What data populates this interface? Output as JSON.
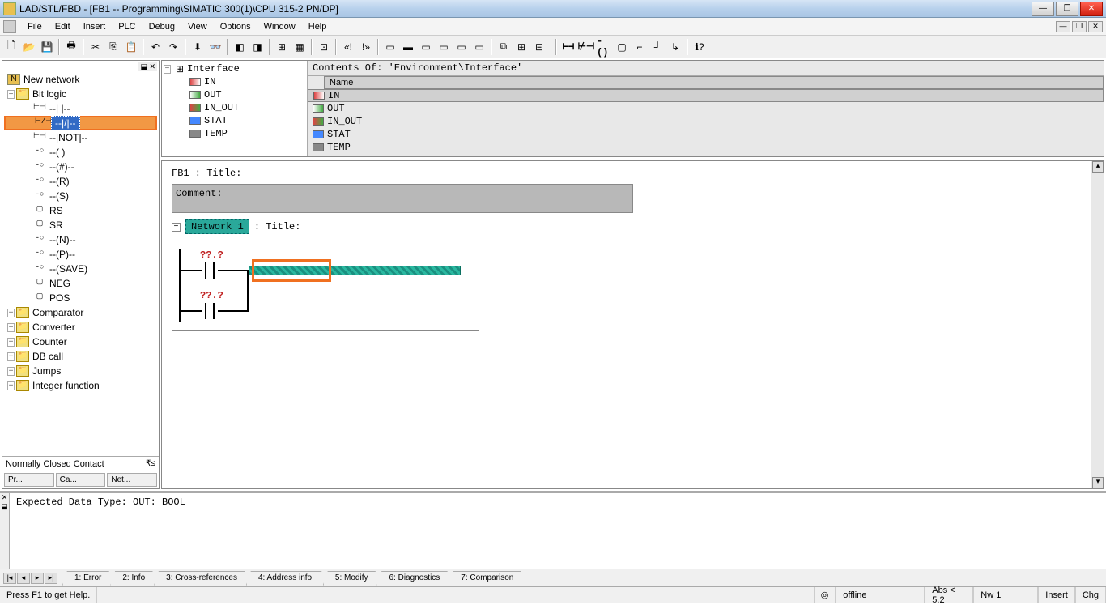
{
  "title": "LAD/STL/FBD  - [FB1 -- Programming\\SIMATIC 300(1)\\CPU 315-2 PN/DP]",
  "menu": [
    "File",
    "Edit",
    "Insert",
    "PLC",
    "Debug",
    "View",
    "Options",
    "Window",
    "Help"
  ],
  "tree": {
    "newnet": "New network",
    "bitlogic": "Bit logic",
    "items": [
      {
        "icon": "-||",
        "label": "--| |--"
      },
      {
        "icon": "-|/|",
        "label": "--|/|--"
      },
      {
        "icon": "-||",
        "label": "--|NOT|--"
      },
      {
        "icon": "-()",
        "label": "--( )"
      },
      {
        "icon": "-()",
        "label": "--(#)--"
      },
      {
        "icon": "-()",
        "label": "--(R)"
      },
      {
        "icon": "-()",
        "label": "--(S)"
      },
      {
        "icon": "[]",
        "label": "RS"
      },
      {
        "icon": "[]",
        "label": "SR"
      },
      {
        "icon": "-()",
        "label": "--(N)--"
      },
      {
        "icon": "-()",
        "label": "--(P)--"
      },
      {
        "icon": "-()",
        "label": "--(SAVE)"
      },
      {
        "icon": "[]",
        "label": "NEG"
      },
      {
        "icon": "[]",
        "label": "POS"
      }
    ],
    "folders": [
      "Comparator",
      "Converter",
      "Counter",
      "DB call",
      "Jumps",
      "Integer function"
    ]
  },
  "hint": "Normally Closed Contact",
  "left_tabs": [
    "Pr...",
    "Ca...",
    "Net..."
  ],
  "iface": {
    "header": "Contents Of: 'Environment\\Interface'",
    "root": "Interface",
    "col": "Name",
    "rows": [
      {
        "type": "in",
        "name": "IN"
      },
      {
        "type": "out",
        "name": "OUT"
      },
      {
        "type": "io",
        "name": "IN_OUT"
      },
      {
        "type": "stat",
        "name": "STAT"
      },
      {
        "type": "temp",
        "name": "TEMP"
      }
    ]
  },
  "ladder": {
    "fb_title": "FB1 : Title:",
    "comment": "Comment:",
    "net_label": "Network 1",
    "net_title": ": Title:",
    "q1": "??.?",
    "q2": "??.?"
  },
  "output": {
    "text": "Expected Data Type: OUT: BOOL",
    "tabs": [
      "1: Error",
      "2: Info",
      "3: Cross-references",
      "4: Address info.",
      "5: Modify",
      "6: Diagnostics",
      "7: Comparison"
    ]
  },
  "status": {
    "help": "Press F1 to get Help.",
    "mode": "offline",
    "abs": "Abs < 5.2",
    "nw": "Nw 1",
    "ins": "Insert",
    "chg": "Chg"
  }
}
